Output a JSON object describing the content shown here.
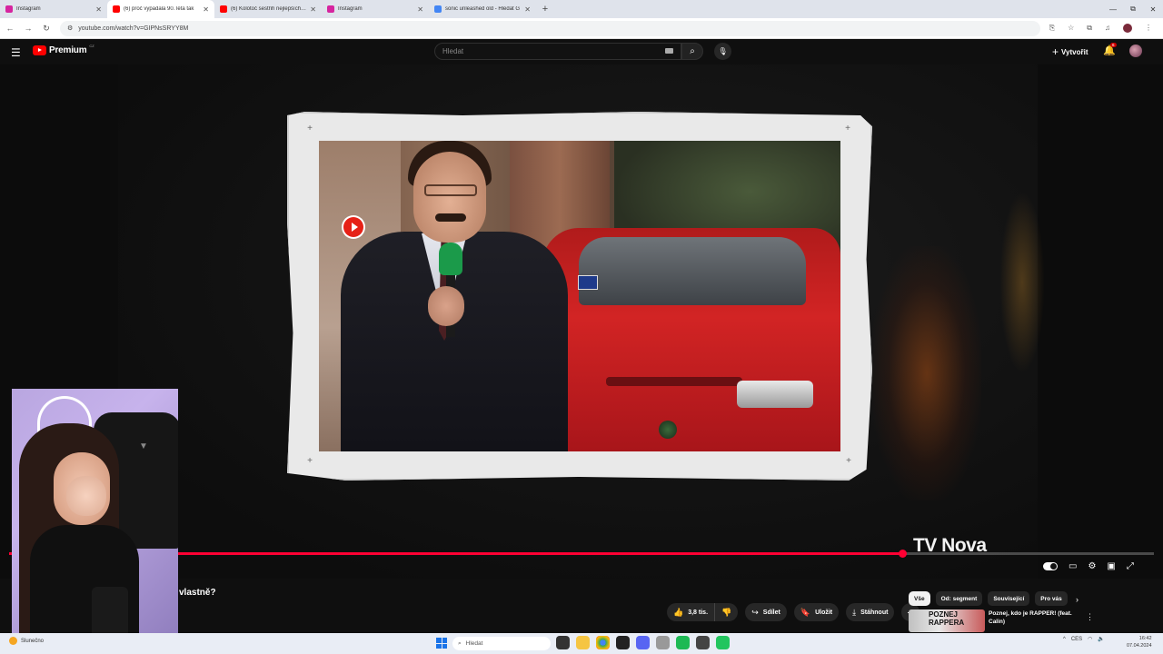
{
  "browser": {
    "tabs": [
      {
        "label": "Instagram",
        "favicon_color": "#d6249f",
        "active": false
      },
      {
        "label": "(6) proč vypadalа 90. léta tak",
        "favicon_color": "#ff0000",
        "active": true
      },
      {
        "label": "(6) Kolotoč sestřih nejlepších sc",
        "favicon_color": "#ff0000",
        "active": false
      },
      {
        "label": "Instagram",
        "favicon_color": "#d6249f",
        "active": false
      },
      {
        "label": "sonic unleashed old - Hledat G",
        "favicon_color": "#4285f4",
        "active": false
      }
    ],
    "new_tab": "+",
    "url": "youtube.com/watch?v=GIPNsSRYY8M",
    "window_controls": [
      "—",
      "⧉",
      "✕"
    ]
  },
  "header": {
    "logo_text": "Premium",
    "logo_sup": "CZ",
    "search_placeholder": "Hledat",
    "create_label": "Vytvořit",
    "notification_count": "6"
  },
  "video": {
    "watermark": "TV Nova",
    "progress_fraction": 0.78
  },
  "below": {
    "title_fragment": "vlastně?",
    "like_count": "3,8 tis.",
    "share_label": "Sdílet",
    "save_label": "Uložit",
    "download_label": "Stáhnout"
  },
  "chips": [
    "Vše",
    "Od: segment",
    "Související",
    "Pro vás"
  ],
  "recommendation": {
    "thumb_text": "POZNEJ RAPPERA",
    "title": "Poznej, kdo je RAPPER! (feat. Calin)"
  },
  "taskbar": {
    "weather": "Slunečno",
    "search_placeholder": "Hledat",
    "language": "CES",
    "time": "16:42",
    "date": "07.04.2024"
  },
  "colors": {
    "accent": "#ff0033",
    "background": "#0f0f0f"
  }
}
